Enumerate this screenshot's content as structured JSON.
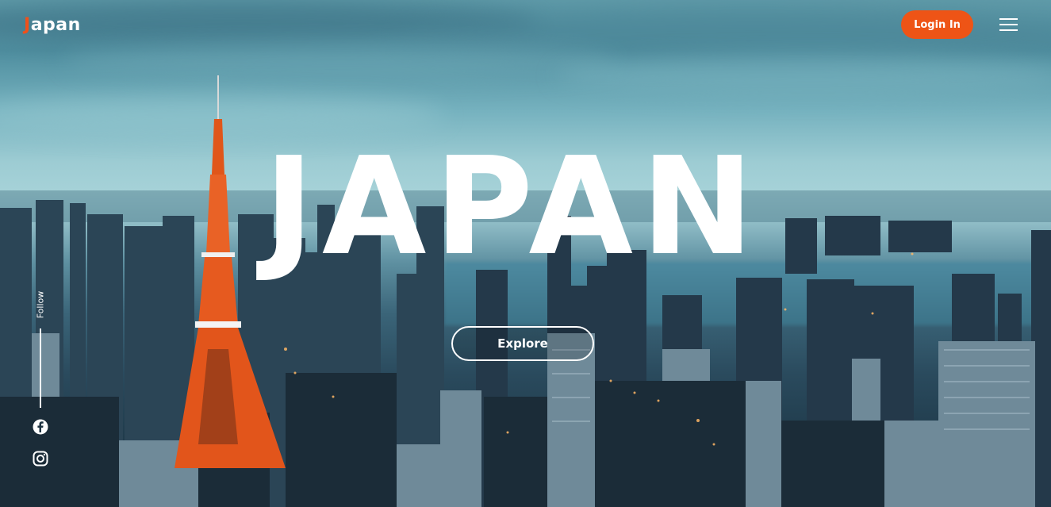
{
  "brand": {
    "logo_first": "J",
    "logo_rest": "apan"
  },
  "header": {
    "login_label": "Login In"
  },
  "hero": {
    "title": "JAPAN",
    "explore_label": "Explore"
  },
  "social": {
    "follow_label": "Follow",
    "items": [
      {
        "name": "facebook-icon"
      },
      {
        "name": "instagram-icon"
      }
    ]
  },
  "colors": {
    "accent": "#ee5416",
    "text": "#ffffff"
  }
}
